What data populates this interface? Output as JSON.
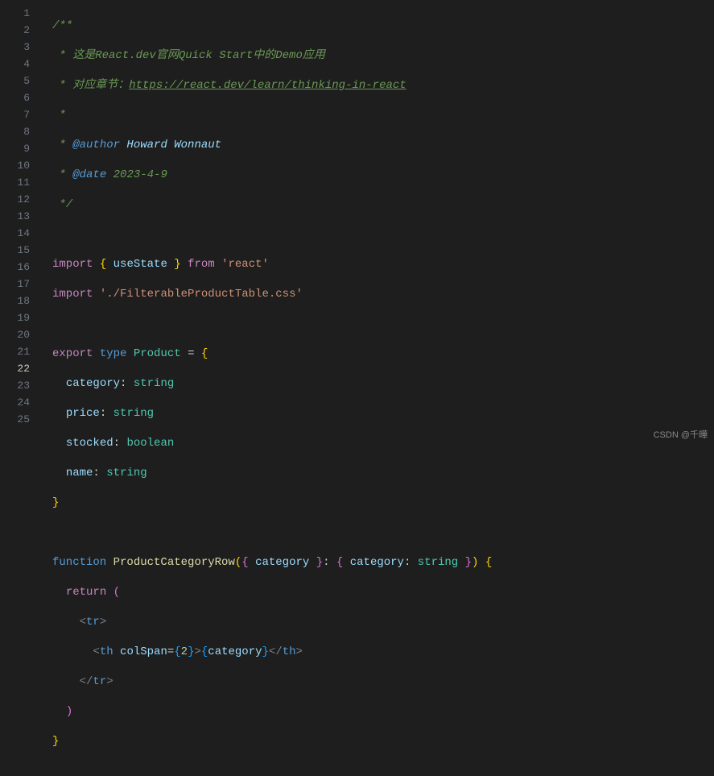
{
  "gutter": {
    "lines": [
      "1",
      "2",
      "3",
      "4",
      "5",
      "6",
      "7",
      "8",
      "9",
      "10",
      "11",
      "12",
      "13",
      "14",
      "15",
      "16",
      "17",
      "18",
      "19",
      "20",
      "21",
      "22",
      "23",
      "24",
      "25"
    ],
    "active": "22"
  },
  "code": {
    "l1": "/**",
    "l2_a": " * ",
    "l2_b": "这是React.dev官网Quick Start中的Demo应用",
    "l3_a": " * ",
    "l3_b": "对应章节：",
    "l3_c": "https://react.dev/learn/thinking-in-react",
    "l4": " *",
    "l5_a": " * ",
    "l5_b": "@author",
    "l5_c": " Howard Wonnaut",
    "l6_a": " * ",
    "l6_b": "@date",
    "l6_c": " 2023-4-9",
    "l7": " */",
    "l9_import": "import",
    "l9_b1": " { ",
    "l9_use": "useState",
    "l9_b2": " } ",
    "l9_from": "from",
    "l9_sp": " ",
    "l9_str": "'react'",
    "l10_import": "import",
    "l10_sp": " ",
    "l10_str": "'./FilterableProductTable.css'",
    "l12_export": "export",
    "l12_sp1": " ",
    "l12_type": "type",
    "l12_sp2": " ",
    "l12_name": "Product",
    "l12_sp3": " ",
    "l12_eq": "=",
    "l12_sp4": " ",
    "l12_brace": "{",
    "l13_ind": "  ",
    "l13_prop": "category",
    "l13_colon": ": ",
    "l13_typ": "string",
    "l14_ind": "  ",
    "l14_prop": "price",
    "l14_colon": ": ",
    "l14_typ": "string",
    "l15_ind": "  ",
    "l15_prop": "stocked",
    "l15_colon": ": ",
    "l15_typ": "boolean",
    "l16_ind": "  ",
    "l16_prop": "name",
    "l16_colon": ": ",
    "l16_typ": "string",
    "l17": "}",
    "l19_fn": "function",
    "l19_sp1": " ",
    "l19_name": "ProductCategoryRow",
    "l19_p1": "(",
    "l19_b1": "{ ",
    "l19_arg": "category",
    "l19_b2": " }",
    "l19_colon": ": ",
    "l19_b3": "{ ",
    "l19_argty": "category",
    "l19_colon2": ": ",
    "l19_ty": "string",
    "l19_b4": " }",
    "l19_p2": ")",
    "l19_sp2": " ",
    "l19_open": "{",
    "l20_ind": "  ",
    "l20_ret": "return",
    "l20_sp": " ",
    "l20_p1": "(",
    "l21_ind": "    ",
    "l21_open": "<",
    "l21_tag": "tr",
    "l21_close": ">",
    "l22_ind": "      ",
    "l22_open": "<",
    "l22_tag": "th",
    "l22_sp": " ",
    "l22_attr": "colSpan",
    "l22_eq": "=",
    "l22_b1": "{",
    "l22_num": "2",
    "l22_b2": "}",
    "l22_gt": ">",
    "l22_eb1": "{",
    "l22_var": "category",
    "l22_eb2": "}",
    "l22_ct1": "</",
    "l22_ctag": "th",
    "l22_ct2": ">",
    "l23_ind": "    ",
    "l23_ct1": "</",
    "l23_tag": "tr",
    "l23_ct2": ">",
    "l24_ind": "  ",
    "l24_p": ")",
    "l25": "}"
  },
  "watermark": "CSDN @千曄"
}
